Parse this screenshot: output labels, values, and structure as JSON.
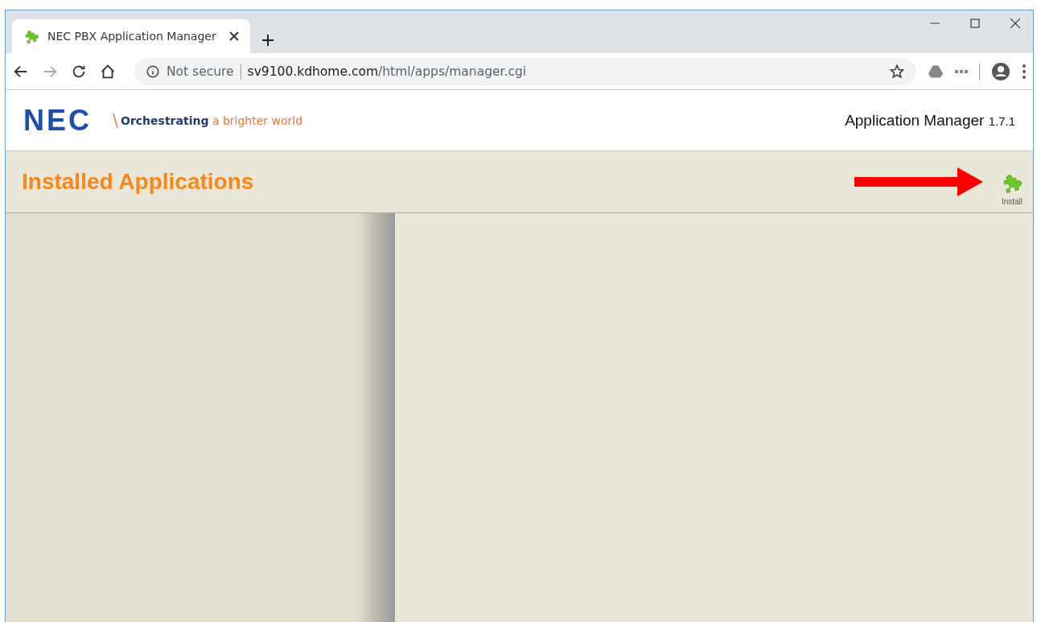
{
  "browser": {
    "tab": {
      "title": "NEC PBX Application Manager",
      "selected": true
    },
    "address": {
      "security": "Not secure",
      "host": "sv9100.kdhome.com",
      "path": "/html/apps/manager.cgi"
    }
  },
  "header": {
    "logo": "NEC",
    "tagline": {
      "lead": "Orchestrating",
      "rest": "a brighter world"
    },
    "app_name": "Application Manager",
    "version": "1.7.1"
  },
  "toolbar": {
    "title": "Installed Applications",
    "install_label": "Install"
  }
}
